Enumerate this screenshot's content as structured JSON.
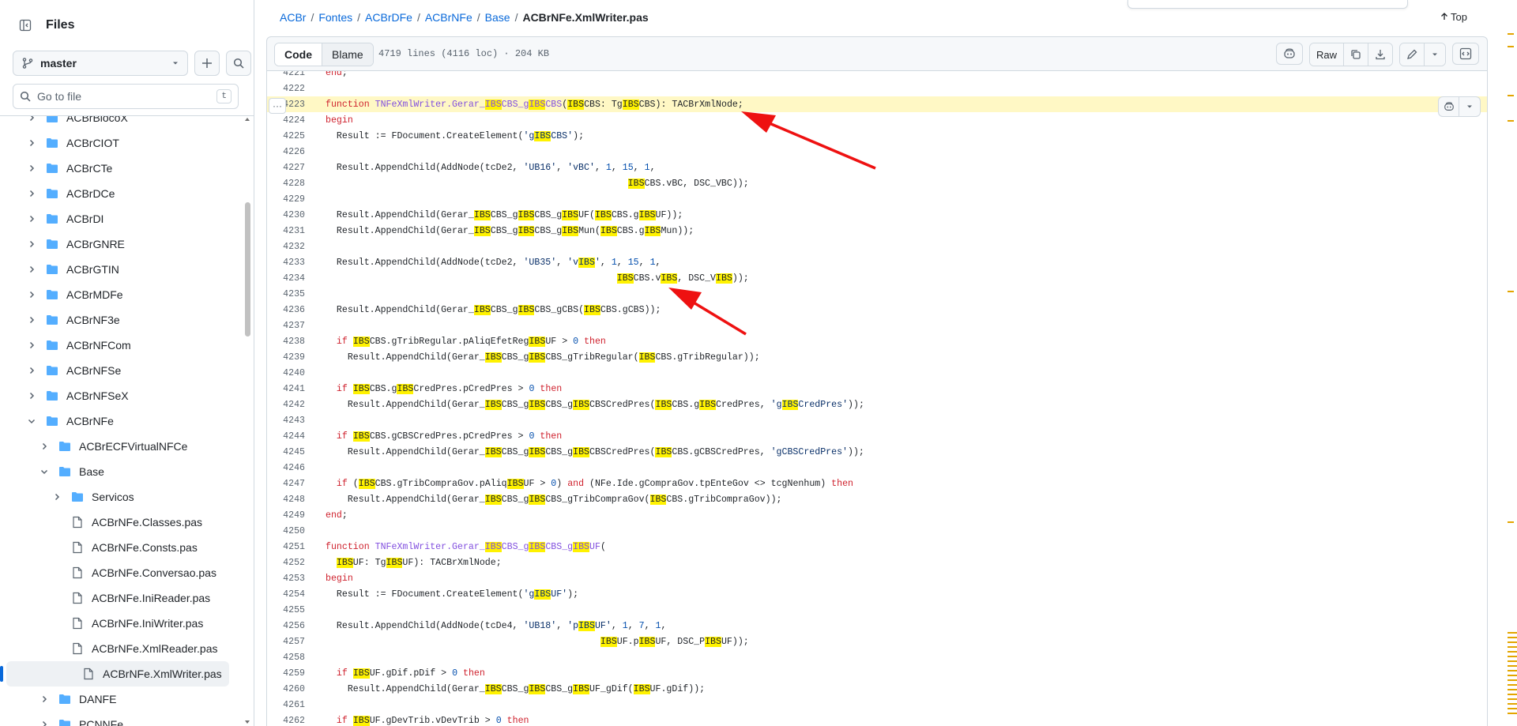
{
  "sidebar": {
    "title": "Files",
    "branch": "master",
    "goto_placeholder": "Go to file",
    "goto_shortcut": "t",
    "items": [
      {
        "label": "ACBrBlocoX",
        "kind": "folder",
        "depth": 0,
        "expanded": false
      },
      {
        "label": "ACBrCIOT",
        "kind": "folder",
        "depth": 0,
        "expanded": false
      },
      {
        "label": "ACBrCTe",
        "kind": "folder",
        "depth": 0,
        "expanded": false
      },
      {
        "label": "ACBrDCe",
        "kind": "folder",
        "depth": 0,
        "expanded": false
      },
      {
        "label": "ACBrDI",
        "kind": "folder",
        "depth": 0,
        "expanded": false
      },
      {
        "label": "ACBrGNRE",
        "kind": "folder",
        "depth": 0,
        "expanded": false
      },
      {
        "label": "ACBrGTIN",
        "kind": "folder",
        "depth": 0,
        "expanded": false
      },
      {
        "label": "ACBrMDFe",
        "kind": "folder",
        "depth": 0,
        "expanded": false
      },
      {
        "label": "ACBrNF3e",
        "kind": "folder",
        "depth": 0,
        "expanded": false
      },
      {
        "label": "ACBrNFCom",
        "kind": "folder",
        "depth": 0,
        "expanded": false
      },
      {
        "label": "ACBrNFSe",
        "kind": "folder",
        "depth": 0,
        "expanded": false
      },
      {
        "label": "ACBrNFSeX",
        "kind": "folder",
        "depth": 0,
        "expanded": false
      },
      {
        "label": "ACBrNFe",
        "kind": "folder",
        "depth": 0,
        "expanded": true
      },
      {
        "label": "ACBrECFVirtualNFCe",
        "kind": "folder",
        "depth": 1,
        "expanded": false
      },
      {
        "label": "Base",
        "kind": "folder",
        "depth": 1,
        "expanded": true
      },
      {
        "label": "Servicos",
        "kind": "folder",
        "depth": 2,
        "expanded": false
      },
      {
        "label": "ACBrNFe.Classes.pas",
        "kind": "file",
        "depth": 2
      },
      {
        "label": "ACBrNFe.Consts.pas",
        "kind": "file",
        "depth": 2
      },
      {
        "label": "ACBrNFe.Conversao.pas",
        "kind": "file",
        "depth": 2
      },
      {
        "label": "ACBrNFe.IniReader.pas",
        "kind": "file",
        "depth": 2
      },
      {
        "label": "ACBrNFe.IniWriter.pas",
        "kind": "file",
        "depth": 2
      },
      {
        "label": "ACBrNFe.XmlReader.pas",
        "kind": "file",
        "depth": 2
      },
      {
        "label": "ACBrNFe.XmlWriter.pas",
        "kind": "file",
        "depth": 2,
        "selected": true
      },
      {
        "label": "DANFE",
        "kind": "folder",
        "depth": 1,
        "expanded": false
      },
      {
        "label": "PCNNFe",
        "kind": "folder",
        "depth": 1,
        "expanded": false
      }
    ]
  },
  "breadcrumb": {
    "parts": [
      "ACBr",
      "Fontes",
      "ACBrDFe",
      "ACBrNFe",
      "Base"
    ],
    "current": "ACBrNFe.XmlWriter.pas",
    "separator": "/"
  },
  "top_link": "Top",
  "toolbar": {
    "code_tab": "Code",
    "blame_tab": "Blame",
    "file_info": "4719 lines (4116 loc) · 204 KB",
    "raw_label": "Raw"
  },
  "colors": {
    "accent": "#0969da",
    "highlight": "#fff200",
    "arrow": "#ee1111"
  },
  "code": {
    "highlighted_line": "4223",
    "lines": [
      {
        "n": "4221",
        "t": "end;"
      },
      {
        "n": "4222",
        "t": ""
      },
      {
        "n": "4223",
        "t": "function TNFeXmlWriter.Gerar_IBSCBS_gIBSCBS(IBSCBS: TgIBSCBS): TACBrXmlNode;"
      },
      {
        "n": "4224",
        "t": "begin"
      },
      {
        "n": "4225",
        "t": "  Result := FDocument.CreateElement('gIBSCBS');"
      },
      {
        "n": "4226",
        "t": ""
      },
      {
        "n": "4227",
        "t": "  Result.AppendChild(AddNode(tcDe2, 'UB16', 'vBC', 1, 15, 1,"
      },
      {
        "n": "4228",
        "t": "                                                       IBSCBS.vBC, DSC_VBC));"
      },
      {
        "n": "4229",
        "t": ""
      },
      {
        "n": "4230",
        "t": "  Result.AppendChild(Gerar_IBSCBS_gIBSCBS_gIBSUF(IBSCBS.gIBSUF));"
      },
      {
        "n": "4231",
        "t": "  Result.AppendChild(Gerar_IBSCBS_gIBSCBS_gIBSMun(IBSCBS.gIBSMun));"
      },
      {
        "n": "4232",
        "t": ""
      },
      {
        "n": "4233",
        "t": "  Result.AppendChild(AddNode(tcDe2, 'UB35', 'vIBS', 1, 15, 1,"
      },
      {
        "n": "4234",
        "t": "                                                     IBSCBS.vIBS, DSC_VIBS));"
      },
      {
        "n": "4235",
        "t": ""
      },
      {
        "n": "4236",
        "t": "  Result.AppendChild(Gerar_IBSCBS_gIBSCBS_gCBS(IBSCBS.gCBS));"
      },
      {
        "n": "4237",
        "t": ""
      },
      {
        "n": "4238",
        "t": "  if IBSCBS.gTribRegular.pAliqEfetRegIBSUF > 0 then"
      },
      {
        "n": "4239",
        "t": "    Result.AppendChild(Gerar_IBSCBS_gIBSCBS_gTribRegular(IBSCBS.gTribRegular));"
      },
      {
        "n": "4240",
        "t": ""
      },
      {
        "n": "4241",
        "t": "  if IBSCBS.gIBSCredPres.pCredPres > 0 then"
      },
      {
        "n": "4242",
        "t": "    Result.AppendChild(Gerar_IBSCBS_gIBSCBS_gIBSCBSCredPres(IBSCBS.gIBSCredPres, 'gIBSCredPres'));"
      },
      {
        "n": "4243",
        "t": ""
      },
      {
        "n": "4244",
        "t": "  if IBSCBS.gCBSCredPres.pCredPres > 0 then"
      },
      {
        "n": "4245",
        "t": "    Result.AppendChild(Gerar_IBSCBS_gIBSCBS_gIBSCBSCredPres(IBSCBS.gCBSCredPres, 'gCBSCredPres'));"
      },
      {
        "n": "4246",
        "t": ""
      },
      {
        "n": "4247",
        "t": "  if (IBSCBS.gTribCompraGov.pAliqIBSUF > 0) and (NFe.Ide.gCompraGov.tpEnteGov <> tcgNenhum) then"
      },
      {
        "n": "4248",
        "t": "    Result.AppendChild(Gerar_IBSCBS_gIBSCBS_gTribCompraGov(IBSCBS.gTribCompraGov));"
      },
      {
        "n": "4249",
        "t": "end;"
      },
      {
        "n": "4250",
        "t": ""
      },
      {
        "n": "4251",
        "t": "function TNFeXmlWriter.Gerar_IBSCBS_gIBSCBS_gIBSUF("
      },
      {
        "n": "4252",
        "t": "  IBSUF: TgIBSUF): TACBrXmlNode;"
      },
      {
        "n": "4253",
        "t": "begin"
      },
      {
        "n": "4254",
        "t": "  Result := FDocument.CreateElement('gIBSUF');"
      },
      {
        "n": "4255",
        "t": ""
      },
      {
        "n": "4256",
        "t": "  Result.AppendChild(AddNode(tcDe4, 'UB18', 'pIBSUF', 1, 7, 1,"
      },
      {
        "n": "4257",
        "t": "                                                  IBSUF.pIBSUF, DSC_PIBSUF));"
      },
      {
        "n": "4258",
        "t": ""
      },
      {
        "n": "4259",
        "t": "  if IBSUF.gDif.pDif > 0 then"
      },
      {
        "n": "4260",
        "t": "    Result.AppendChild(Gerar_IBSCBS_gIBSCBS_gIBSUF_gDif(IBSUF.gDif));"
      },
      {
        "n": "4261",
        "t": ""
      },
      {
        "n": "4262",
        "t": "  if IBSUF.gDevTrib.vDevTrib > 0 then"
      }
    ]
  }
}
